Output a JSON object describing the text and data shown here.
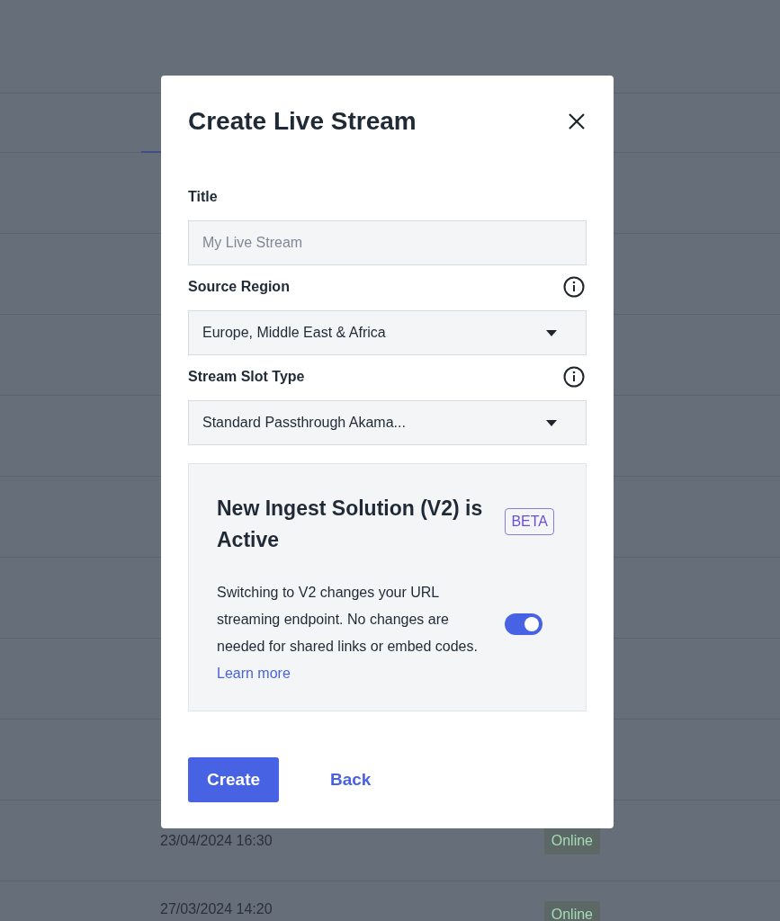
{
  "background": {
    "rows": [
      {
        "date": "23/04/2024 16:30",
        "status": "Online"
      },
      {
        "date": "27/03/2024 14:20",
        "status": "Online"
      }
    ]
  },
  "dialog": {
    "title": "Create Live Stream",
    "fields": [
      {
        "label": "Title",
        "kind": "text",
        "placeholder": "My Live Stream",
        "info": false
      },
      {
        "label": "Source Region",
        "kind": "select",
        "value": "Europe, Middle East & Africa",
        "info": true
      },
      {
        "label": "Stream Slot Type",
        "kind": "select",
        "value": "Standard Passthrough Akama...",
        "info": true
      }
    ],
    "notice": {
      "title": "New Ingest Solution (V2) is Active",
      "badge": "BETA",
      "text": "Switching to V2 changes your URL streaming endpoint. No changes are needed for shared links or embed codes.",
      "link": "Learn more",
      "toggle": {
        "on": true
      }
    },
    "buttons": [
      {
        "label": "Create",
        "kind": "primary"
      },
      {
        "label": "Back",
        "kind": "link"
      }
    ]
  }
}
